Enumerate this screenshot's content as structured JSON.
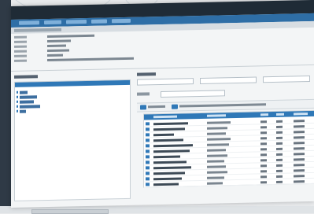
{
  "window": {
    "title": "",
    "nav_items": [
      "",
      "",
      "",
      "",
      ""
    ]
  },
  "breadcrumb": "",
  "info": {
    "fields": [
      {
        "key": "",
        "value": ""
      },
      {
        "key": "",
        "value": ""
      },
      {
        "key": "",
        "value": ""
      },
      {
        "key": "",
        "value": ""
      },
      {
        "key": "",
        "value": ""
      },
      {
        "key": "",
        "value": ""
      }
    ]
  },
  "left_panel": {
    "title": "",
    "tree_items": [
      "",
      "",
      "",
      "",
      ""
    ]
  },
  "right_panel": {
    "title": "",
    "search_fields": [
      "",
      "",
      ""
    ],
    "filter_label": "",
    "filter_value": "",
    "toolbar": {
      "button_1": "",
      "button_2": ""
    },
    "grid": {
      "columns": [
        "",
        "",
        "",
        "",
        ""
      ],
      "rows": [
        {
          "name": "",
          "type": "",
          "c1": "",
          "c2": "",
          "c3": ""
        },
        {
          "name": "",
          "type": "",
          "c1": "",
          "c2": "",
          "c3": ""
        },
        {
          "name": "",
          "type": "",
          "c1": "",
          "c2": "",
          "c3": ""
        },
        {
          "name": "",
          "type": "",
          "c1": "",
          "c2": "",
          "c3": ""
        },
        {
          "name": "",
          "type": "",
          "c1": "",
          "c2": "",
          "c3": ""
        },
        {
          "name": "",
          "type": "",
          "c1": "",
          "c2": "",
          "c3": ""
        },
        {
          "name": "",
          "type": "",
          "c1": "",
          "c2": "",
          "c3": ""
        },
        {
          "name": "",
          "type": "",
          "c1": "",
          "c2": "",
          "c3": ""
        },
        {
          "name": "",
          "type": "",
          "c1": "",
          "c2": "",
          "c3": ""
        },
        {
          "name": "",
          "type": "",
          "c1": "",
          "c2": "",
          "c3": ""
        },
        {
          "name": "",
          "type": "",
          "c1": "",
          "c2": "",
          "c3": ""
        },
        {
          "name": "",
          "type": "",
          "c1": "",
          "c2": "",
          "c3": ""
        }
      ]
    }
  },
  "status_bar": "",
  "colors": {
    "titlebar": "#1f2b36",
    "nav": "#2e6ea6",
    "accent": "#2f78b7",
    "panel_bg": "#f3f5f6"
  }
}
